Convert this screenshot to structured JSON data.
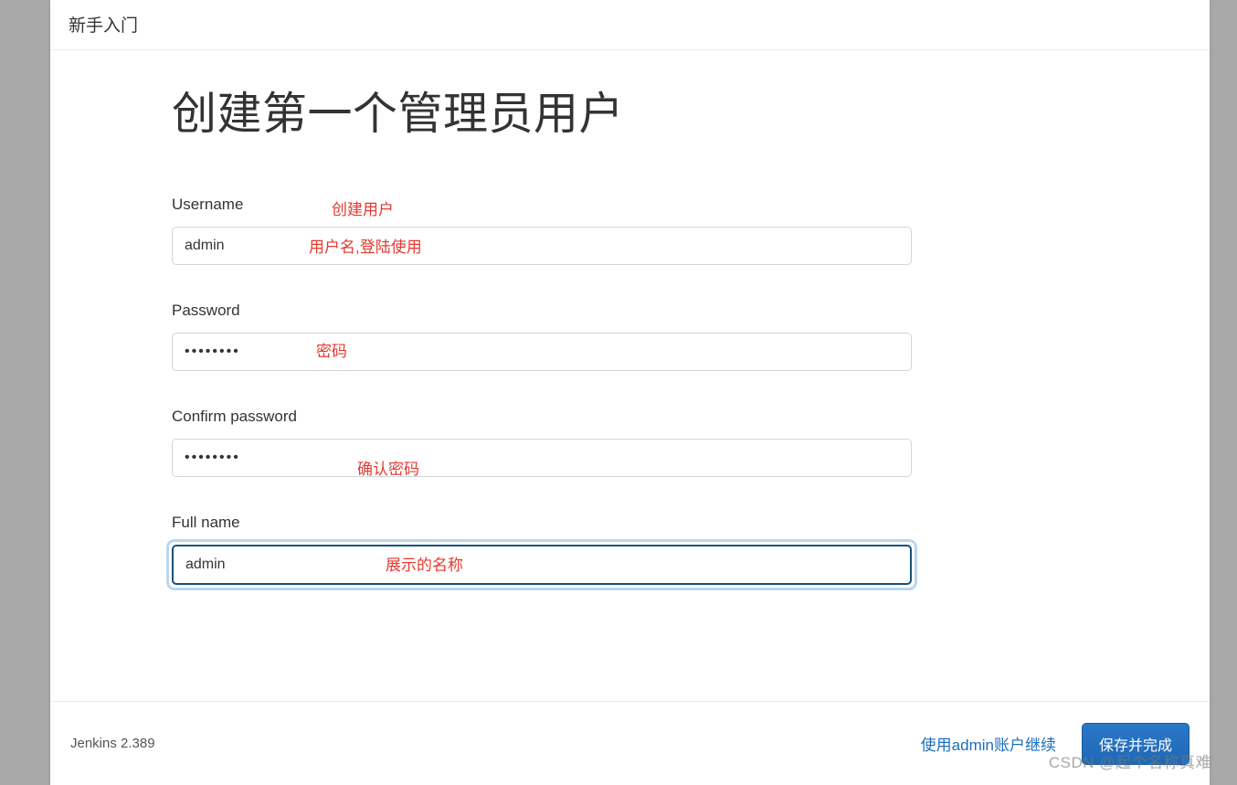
{
  "header": {
    "title": "新手入门"
  },
  "main": {
    "page_title": "创建第一个管理员用户",
    "annotations": {
      "create_user": "创建用户",
      "username_hint": "用户名,登陆使用",
      "password_hint": "密码",
      "confirm_hint": "确认密码",
      "fullname_hint": "展示的名称"
    },
    "fields": {
      "username": {
        "label": "Username",
        "value": "admin"
      },
      "password": {
        "label": "Password",
        "value": "••••••••"
      },
      "confirm": {
        "label": "Confirm password",
        "value": "••••••••"
      },
      "fullname": {
        "label": "Full name",
        "value": "admin"
      }
    }
  },
  "footer": {
    "version": "Jenkins 2.389",
    "skip_label": "使用admin账户继续",
    "save_label": "保存并完成"
  },
  "watermark": "CSDN @起个名称真难"
}
